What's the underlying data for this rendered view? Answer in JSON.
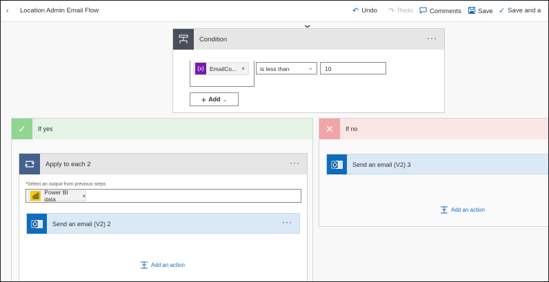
{
  "topbar": {
    "back_icon": "chevron-left-icon",
    "title": "Location Admin Email Flow",
    "undo": "Undo",
    "redo": "Redo",
    "comments": "Comments",
    "save": "Save",
    "save_and": "Save and a"
  },
  "condition": {
    "title": "Condition",
    "more": "···",
    "token_label": "EmailCo...",
    "token_icon_text": "{x}",
    "token_remove": "×",
    "operator": "is less than",
    "value": "10",
    "add_label": "Add"
  },
  "branch_yes": {
    "title": "If yes",
    "apply": {
      "title": "Apply to each 2",
      "more": "···",
      "field_label": "Select an output from previous steps",
      "required_mark": "*",
      "token_label": "Power BI data",
      "token_remove": "×"
    },
    "email": {
      "title": "Send an email (V2) 2",
      "more": "···"
    },
    "add_action": "Add an action"
  },
  "branch_no": {
    "title": "If no",
    "email": {
      "title": "Send an email (V2) 3"
    },
    "add_action": "Add an action"
  },
  "colors": {
    "accent": "#0f6cbd",
    "variable_token": "#7719aa",
    "powerbi_token": "#f2c811",
    "yes_header": "#e5f3e5",
    "no_header": "#fbe6e6"
  }
}
